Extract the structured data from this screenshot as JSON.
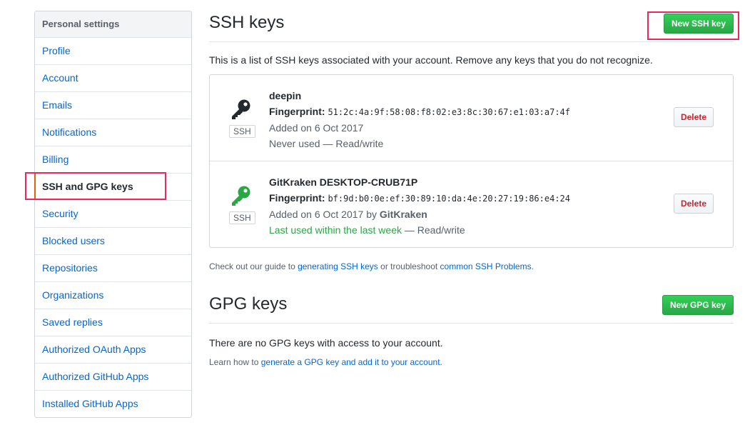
{
  "sidebar": {
    "header": "Personal settings",
    "items": [
      {
        "label": "Profile"
      },
      {
        "label": "Account"
      },
      {
        "label": "Emails"
      },
      {
        "label": "Notifications"
      },
      {
        "label": "Billing"
      },
      {
        "label": "SSH and GPG keys",
        "selected": true
      },
      {
        "label": "Security"
      },
      {
        "label": "Blocked users"
      },
      {
        "label": "Repositories"
      },
      {
        "label": "Organizations"
      },
      {
        "label": "Saved replies"
      },
      {
        "label": "Authorized OAuth Apps"
      },
      {
        "label": "Authorized GitHub Apps"
      },
      {
        "label": "Installed GitHub Apps"
      }
    ]
  },
  "ssh": {
    "title": "SSH keys",
    "new_button": "New SSH key",
    "intro": "This is a list of SSH keys associated with your account. Remove any keys that you do not recognize.",
    "keys": [
      {
        "title": "deepin",
        "fingerprint_label": "Fingerprint:",
        "fingerprint": "51:2c:4a:9f:58:08:f8:02:e3:8c:30:67:e1:03:a7:4f",
        "added": "Added on 6 Oct 2017",
        "added_by": "",
        "usage_status": "Never used",
        "usage_recent": false,
        "access": " — Read/write",
        "tag": "SSH",
        "icon": "key-icon",
        "icon_color": "#24292e",
        "delete_label": "Delete"
      },
      {
        "title": "GitKraken DESKTOP-CRUB71P",
        "fingerprint_label": "Fingerprint:",
        "fingerprint": "bf:9d:b0:0e:ef:30:89:10:da:4e:20:27:19:86:e4:24",
        "added": "Added on 6 Oct 2017 by ",
        "added_by": "GitKraken",
        "usage_status": "Last used within the last week",
        "usage_recent": true,
        "access": " — Read/write",
        "tag": "SSH",
        "icon": "key-icon",
        "icon_color": "#28a745",
        "delete_label": "Delete"
      }
    ],
    "help_prefix": "Check out our guide to ",
    "help_link1": "generating SSH keys",
    "help_mid": " or troubleshoot ",
    "help_link2": "common SSH Problems",
    "help_suffix": "."
  },
  "gpg": {
    "title": "GPG keys",
    "new_button": "New GPG key",
    "empty": "There are no GPG keys with access to your account.",
    "help_prefix": "Learn how to ",
    "help_link": "generate a GPG key and add it to your account",
    "help_suffix": "."
  },
  "colors": {
    "link": "#0366d6",
    "primary_button": "#28a745",
    "danger": "#cb2431",
    "annotation": "#e8295a"
  }
}
